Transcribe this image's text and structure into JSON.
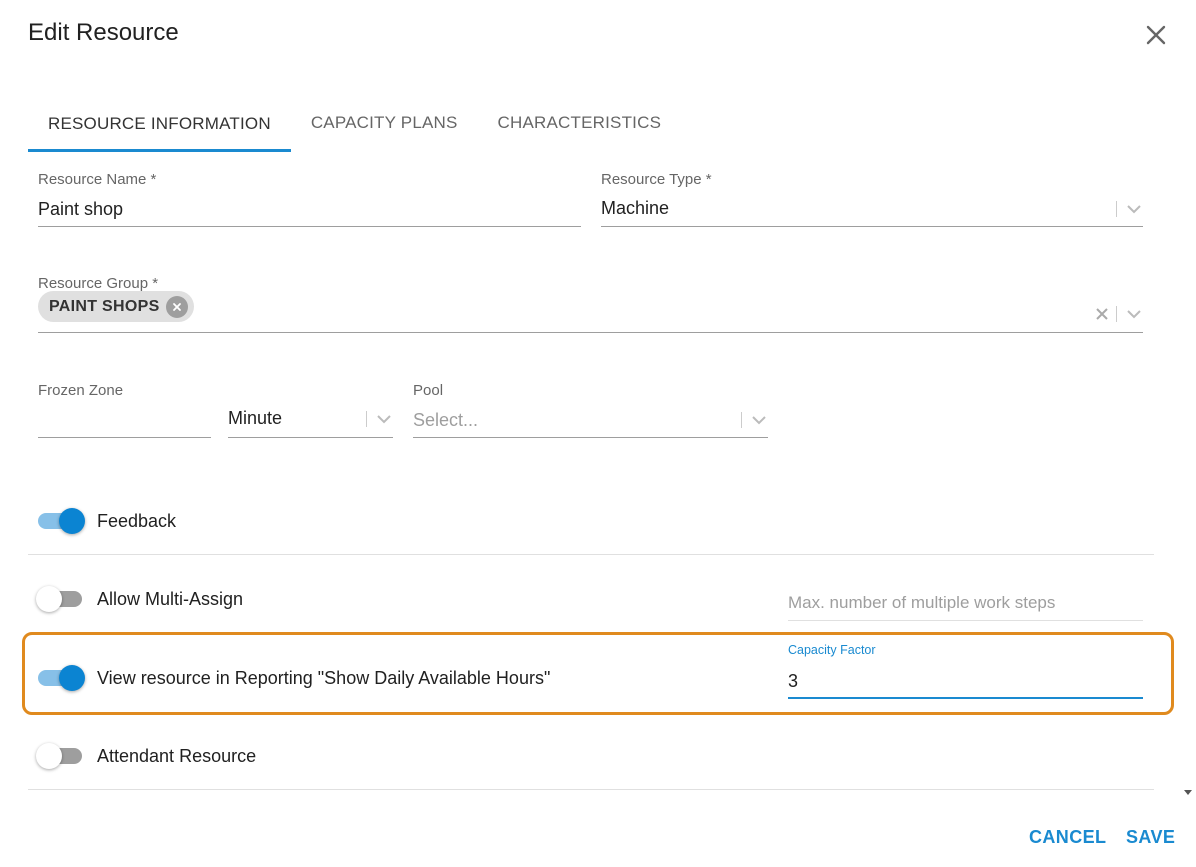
{
  "dialog": {
    "title": "Edit Resource"
  },
  "tabs": [
    {
      "label": "RESOURCE INFORMATION",
      "active": true
    },
    {
      "label": "CAPACITY PLANS",
      "active": false
    },
    {
      "label": "CHARACTERISTICS",
      "active": false
    }
  ],
  "form": {
    "resource_name": {
      "label": "Resource Name *",
      "value": "Paint shop"
    },
    "resource_type": {
      "label": "Resource Type *",
      "value": "Machine"
    },
    "resource_group": {
      "label": "Resource Group *",
      "chips": [
        "PAINT SHOPS"
      ]
    },
    "frozen_zone": {
      "label": "Frozen Zone",
      "value": "",
      "unit": "Minute"
    },
    "pool": {
      "label": "Pool",
      "placeholder": "Select..."
    },
    "feedback": {
      "label": "Feedback",
      "on": true
    },
    "allow_multi_assign": {
      "label": "Allow Multi-Assign",
      "on": false,
      "max_steps_placeholder": "Max. number of multiple work steps"
    },
    "view_in_reporting": {
      "label": "View resource in Reporting \"Show Daily Available Hours\"",
      "on": true
    },
    "capacity_factor": {
      "label": "Capacity Factor",
      "value": "3"
    },
    "attendant_resource": {
      "label": "Attendant Resource",
      "on": false
    }
  },
  "actions": {
    "cancel_label": "CANCEL",
    "save_label": "SAVE"
  },
  "colors": {
    "accent": "#1a8ad0",
    "toggle_on": "#0b84d2",
    "highlight": "#e08a1e"
  }
}
